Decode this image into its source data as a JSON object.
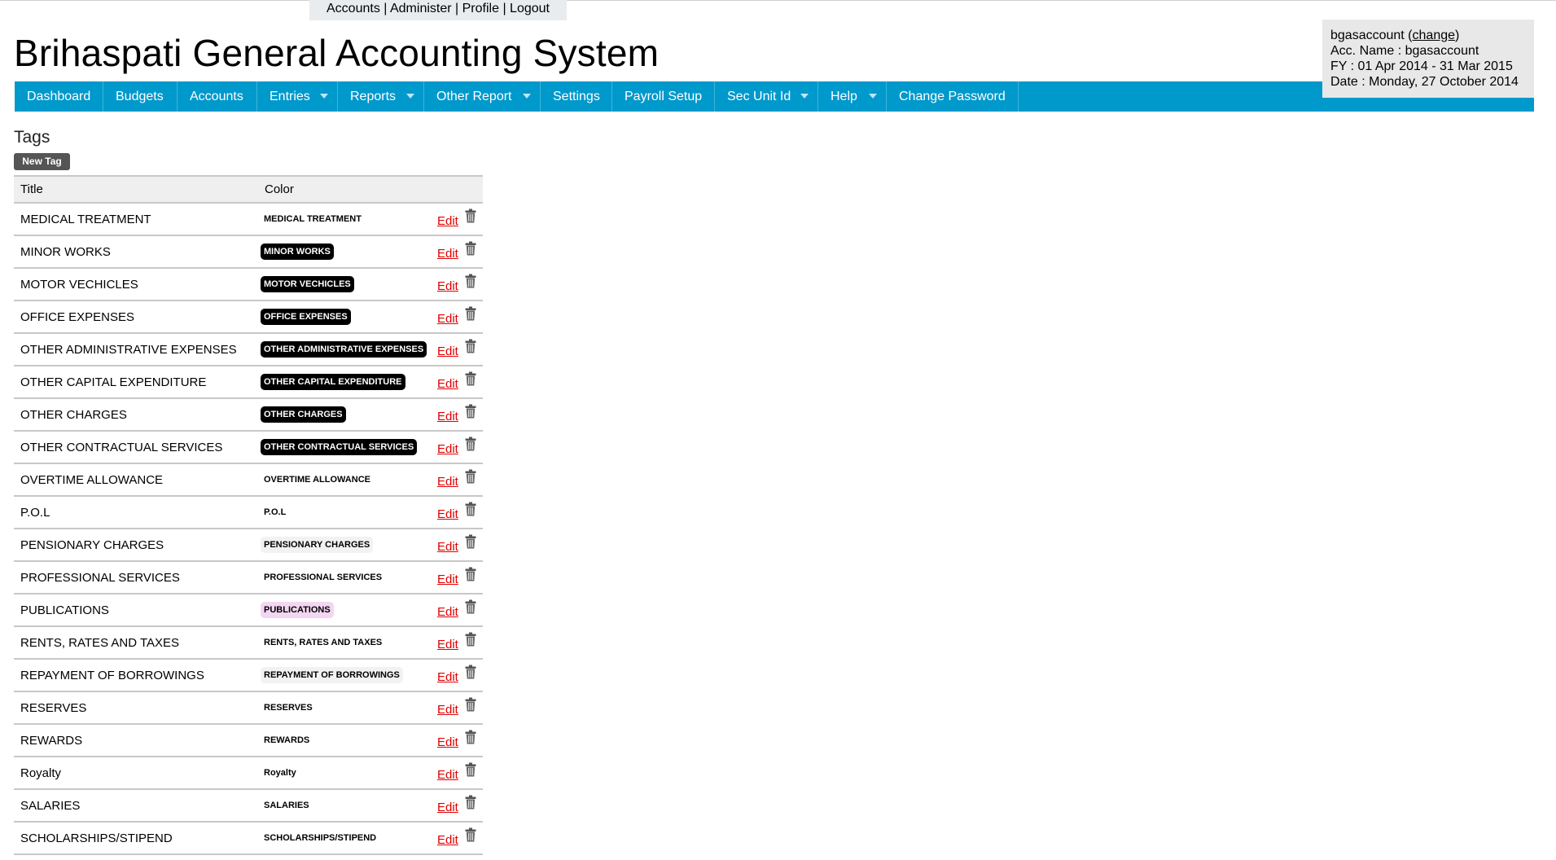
{
  "top_links": {
    "items": [
      "Accounts",
      "Administer",
      "Profile",
      "Logout"
    ],
    "separator": "|"
  },
  "app_title": "Brihaspati General Accounting System",
  "account": {
    "username": "bgasaccount",
    "change_label": "change",
    "acc_name_label": "Acc. Name : bgasaccount",
    "fy_label": "FY : 01 Apr 2014 - 31 Mar 2015",
    "date_label": "Date : Monday, 27 October 2014"
  },
  "nav": [
    {
      "label": "Dashboard",
      "dropdown": false
    },
    {
      "label": "Budgets",
      "dropdown": false
    },
    {
      "label": "Accounts",
      "dropdown": false
    },
    {
      "label": "Entries",
      "dropdown": true
    },
    {
      "label": "Reports",
      "dropdown": true
    },
    {
      "label": "Other Report",
      "dropdown": true
    },
    {
      "label": "Settings",
      "dropdown": false
    },
    {
      "label": "Payroll Setup",
      "dropdown": false
    },
    {
      "label": "Sec Unit Id",
      "dropdown": true
    },
    {
      "label": "Help",
      "dropdown": true
    },
    {
      "label": "Change Password",
      "dropdown": false
    }
  ],
  "colors": {
    "nav_bar": "#0099cc",
    "edit_link": "#e00000",
    "tag_black": "#000000",
    "tag_pink": "#f3d6f1",
    "tag_light": "#f2f2f2"
  },
  "page": {
    "heading": "Tags",
    "new_tag_button": "New Tag"
  },
  "table": {
    "columns": [
      "Title",
      "Color"
    ],
    "edit_label": "Edit",
    "delete_icon": "trash-icon",
    "rows": [
      {
        "title": "MEDICAL TREATMENT",
        "label": "MEDICAL TREATMENT",
        "style": "plain"
      },
      {
        "title": "MINOR WORKS",
        "label": "MINOR WORKS",
        "style": "black"
      },
      {
        "title": "MOTOR VECHICLES",
        "label": "MOTOR VECHICLES",
        "style": "black"
      },
      {
        "title": "OFFICE EXPENSES",
        "label": "OFFICE EXPENSES",
        "style": "black"
      },
      {
        "title": "OTHER ADMINISTRATIVE EXPENSES",
        "label": "OTHER ADMINISTRATIVE EXPENSES",
        "style": "black"
      },
      {
        "title": "OTHER CAPITAL EXPENDITURE",
        "label": "OTHER CAPITAL EXPENDITURE",
        "style": "black"
      },
      {
        "title": "OTHER CHARGES",
        "label": "OTHER CHARGES",
        "style": "black"
      },
      {
        "title": "OTHER CONTRACTUAL SERVICES",
        "label": "OTHER CONTRACTUAL SERVICES",
        "style": "black"
      },
      {
        "title": "OVERTIME ALLOWANCE",
        "label": "OVERTIME ALLOWANCE",
        "style": "plain"
      },
      {
        "title": "P.O.L",
        "label": "P.O.L",
        "style": "plain"
      },
      {
        "title": "PENSIONARY CHARGES",
        "label": "PENSIONARY CHARGES",
        "style": "light"
      },
      {
        "title": "PROFESSIONAL SERVICES",
        "label": "PROFESSIONAL SERVICES",
        "style": "plain"
      },
      {
        "title": "PUBLICATIONS",
        "label": "PUBLICATIONS",
        "style": "pink"
      },
      {
        "title": "RENTS, RATES AND TAXES",
        "label": "RENTS, RATES AND TAXES",
        "style": "plain"
      },
      {
        "title": "REPAYMENT OF BORROWINGS",
        "label": "REPAYMENT OF BORROWINGS",
        "style": "light"
      },
      {
        "title": "RESERVES",
        "label": "RESERVES",
        "style": "plain"
      },
      {
        "title": "REWARDS",
        "label": "REWARDS",
        "style": "plain"
      },
      {
        "title": "Royalty",
        "label": "Royalty",
        "style": "plain"
      },
      {
        "title": "SALARIES",
        "label": "SALARIES",
        "style": "plain"
      },
      {
        "title": "SCHOLARSHIPS/STIPEND",
        "label": "SCHOLARSHIPS/STIPEND",
        "style": "plain"
      }
    ]
  }
}
